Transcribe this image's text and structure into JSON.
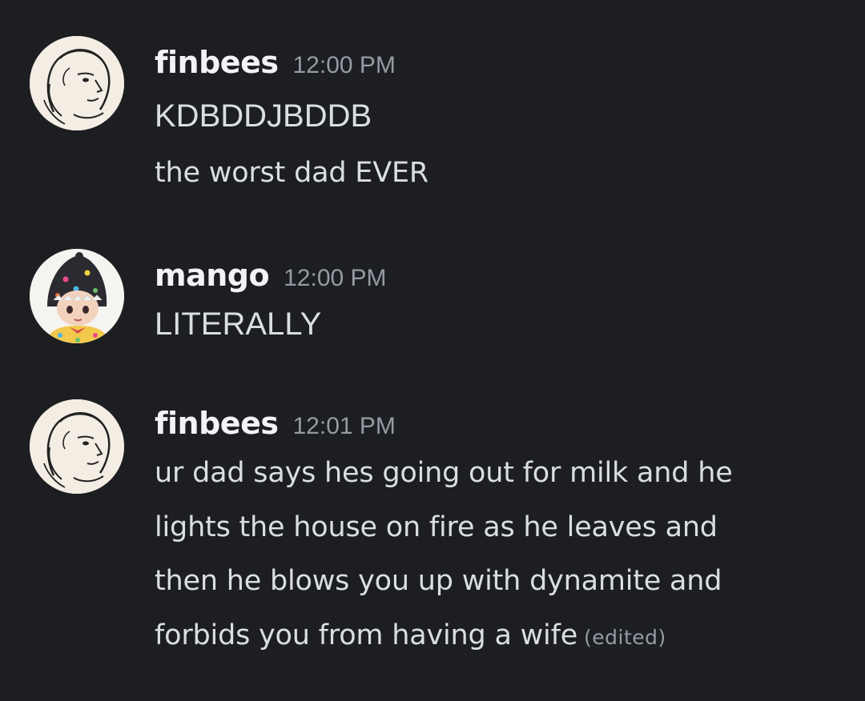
{
  "messages": [
    {
      "username": "finbees",
      "timestamp": "12:00 PM",
      "avatar_icon": "sketch-girl-avatar",
      "lines": [
        "KDBDDJBDDB",
        "the worst dad EVER"
      ]
    },
    {
      "username": "mango",
      "timestamp": "12:00 PM",
      "avatar_icon": "jester-doll-avatar",
      "lines": [
        "LITERALLY"
      ]
    },
    {
      "username": "finbees",
      "timestamp": "12:01 PM",
      "avatar_icon": "sketch-girl-avatar",
      "lines": [
        "ur dad says hes going out for milk and he",
        "lights the house on fire as he leaves and",
        "then he blows you up with dynamite and",
        "forbids you from having a wife"
      ],
      "edited_label": "(edited)"
    }
  ],
  "colors": {
    "background": "#1d1e22",
    "username": "#f2f3f5",
    "text": "#dbdee1",
    "muted": "#949ba4"
  }
}
